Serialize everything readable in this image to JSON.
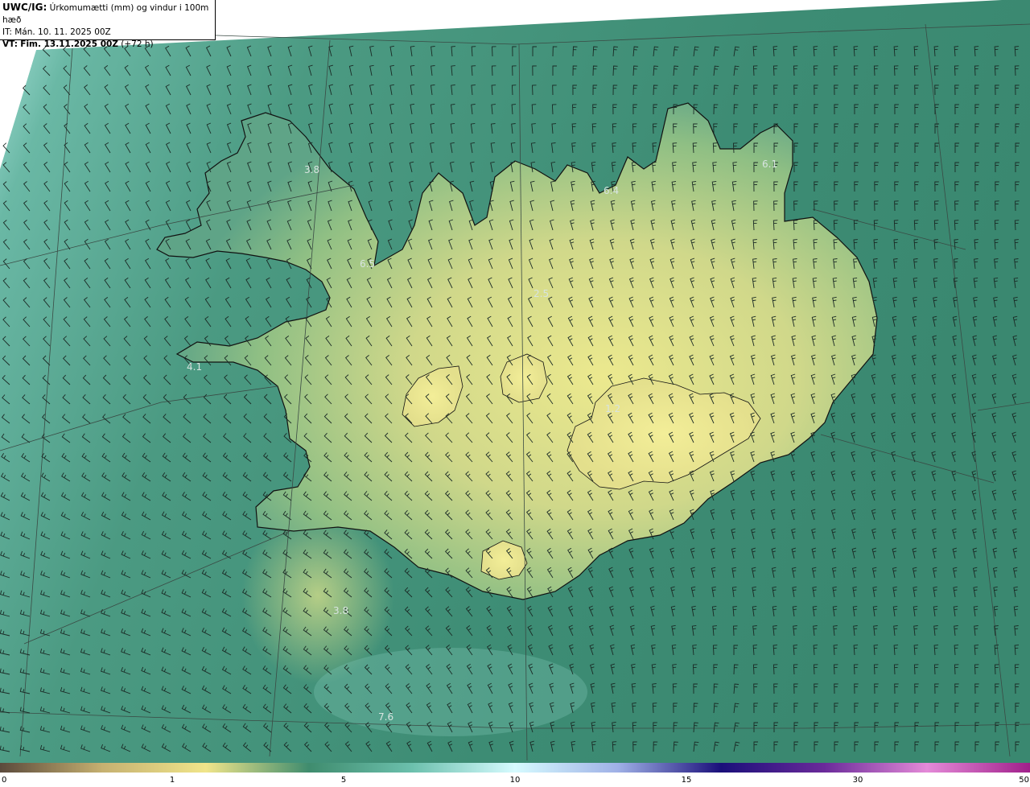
{
  "header": {
    "model": "UWC/IG:",
    "title": "Úrkomumætti (mm) og vindur i 100m hæð",
    "init_time": "IT: Mán. 10. 11. 2025 00Z",
    "valid_label": "VT:",
    "valid_time": "Fim. 13.11.2025 00Z",
    "lead": "(+72 h)"
  },
  "colors": {
    "ocean_low": "#3e8f78",
    "ocean_mid": "#5aa892",
    "ocean_light": "#a7e1d9",
    "land_high": "#e6e38c",
    "land_mid": "#a7c786",
    "coast": "#111111",
    "barb": "#1a2a25",
    "grid": "#3a4a44"
  },
  "map_labels": [
    {
      "text": "3.8"
    },
    {
      "text": "6.5"
    },
    {
      "text": "4.1"
    },
    {
      "text": "2.5"
    },
    {
      "text": "6.4"
    },
    {
      "text": "6.1"
    },
    {
      "text": "1.2"
    },
    {
      "text": "3.8"
    },
    {
      "text": "7.6"
    }
  ],
  "colorbar": {
    "ticks": [
      "0",
      "1",
      "5",
      "10",
      "15",
      "30",
      "50"
    ],
    "stops": [
      "#5b4a3c",
      "#c6b171",
      "#f0e58a",
      "#3f8c6e",
      "#6cc0ad",
      "#d6fbff",
      "#9fb0e6",
      "#1a0f7a",
      "#6a2a9a",
      "#e48ad8",
      "#a01f8a"
    ]
  }
}
